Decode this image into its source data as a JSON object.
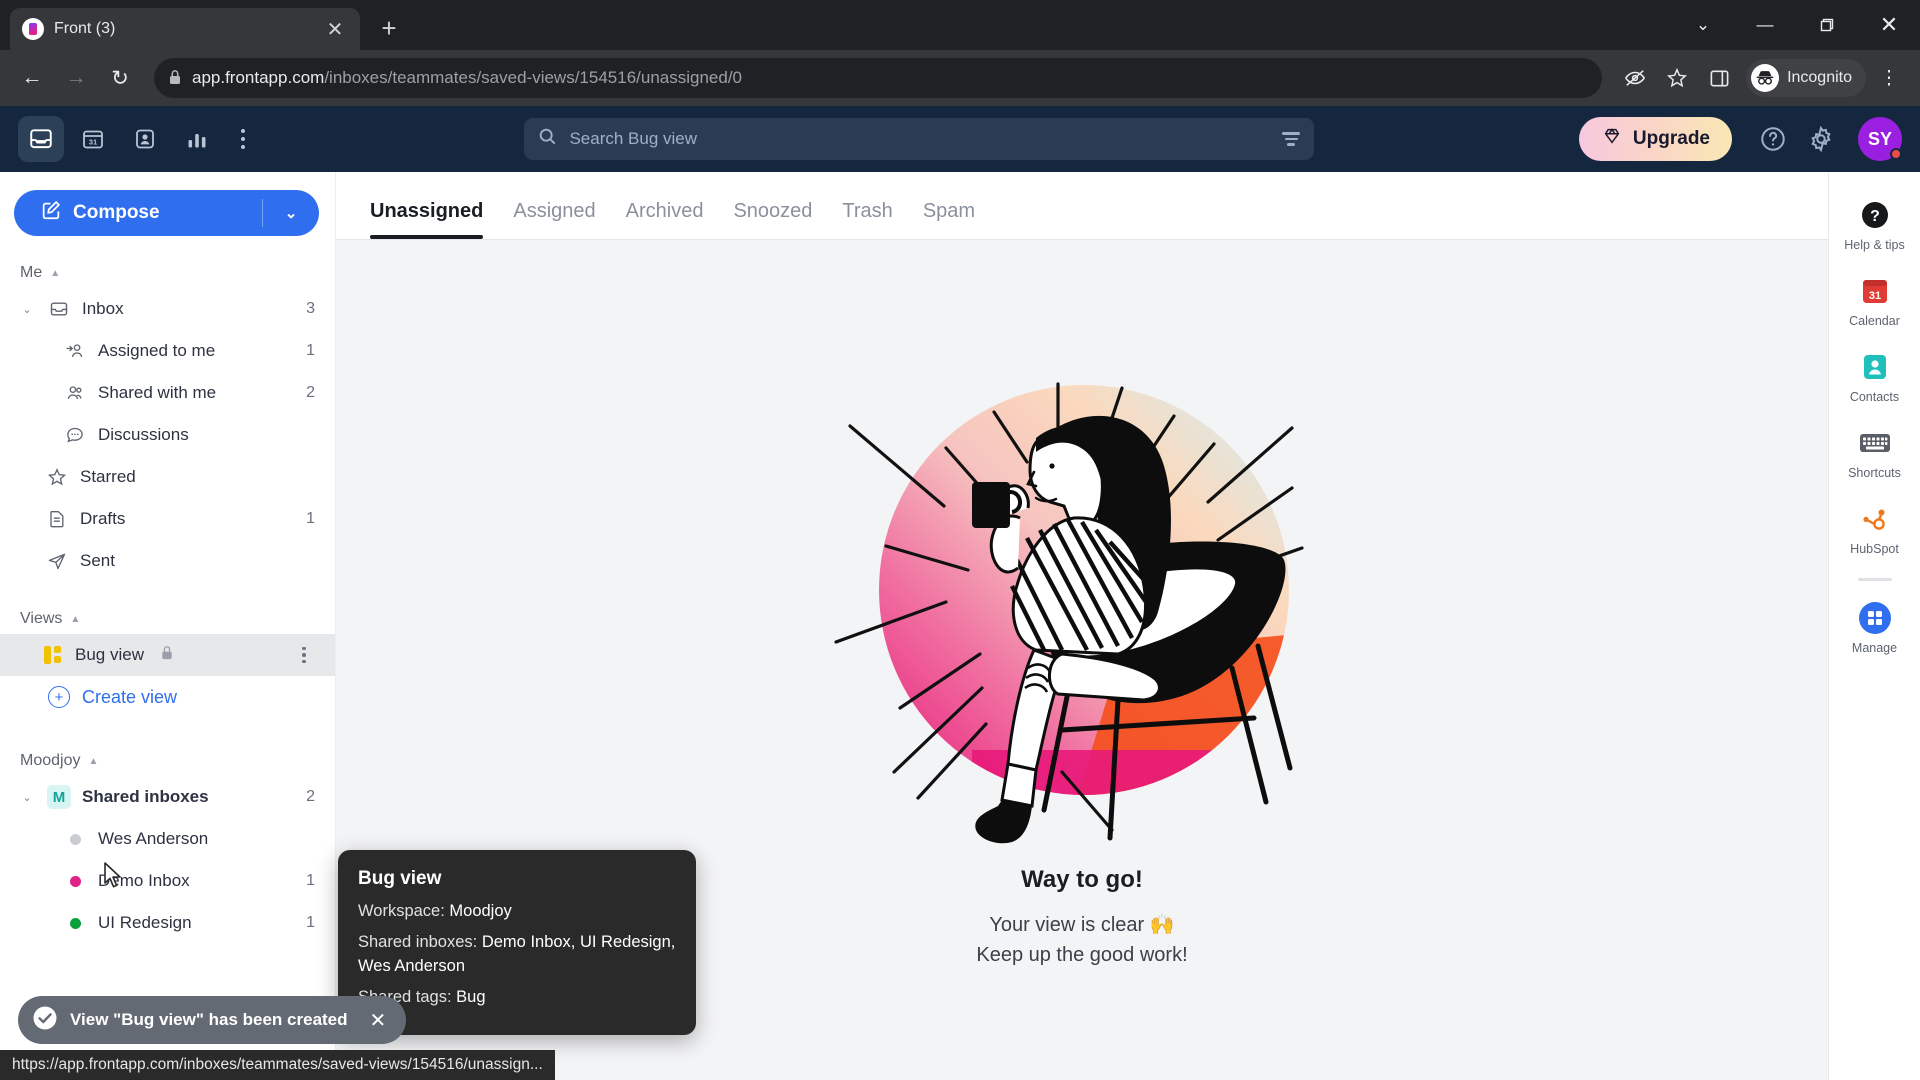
{
  "browser": {
    "tab": {
      "title": "Front (3)",
      "favicon": "front-logo-icon",
      "close_label": "✕"
    },
    "new_tab_label": "+",
    "window_controls": {
      "minimize_group": "⌄",
      "minimize": "—",
      "maximize": "❐",
      "close": "✕"
    },
    "nav": {
      "back": "←",
      "forward": "→",
      "reload": "↻"
    },
    "omnibox": {
      "lock_icon": "lock-icon",
      "url_domain": "app.frontapp.com",
      "url_path": "/inboxes/teammates/saved-views/154516/unassigned/0"
    },
    "toolbar_icons": [
      {
        "name": "third-party-cookies-blocked-icon",
        "glyph": "⌾"
      },
      {
        "name": "bookmark-star-icon",
        "glyph": "☆"
      },
      {
        "name": "side-panel-icon",
        "glyph": "▧"
      }
    ],
    "incognito_label": "Incognito",
    "menu_glyph": "⋮"
  },
  "app_header": {
    "nav_icons": [
      {
        "name": "inbox-icon",
        "label": "Inbox",
        "active": true
      },
      {
        "name": "calendar-icon",
        "label": "Calendar",
        "active": false
      },
      {
        "name": "contacts-icon",
        "label": "Contacts",
        "active": false
      },
      {
        "name": "analytics-icon",
        "label": "Analytics",
        "active": false
      }
    ],
    "more_menu": "more-options-icon",
    "search": {
      "placeholder": "Search Bug view",
      "value": "",
      "icon": "search-icon",
      "filter_icon": "filter-icon"
    },
    "upgrade_label": "Upgrade",
    "upgrade_icon": "diamond-icon",
    "help_icon": "help-circle-icon",
    "settings_icon": "gear-icon",
    "avatar_initials": "SY"
  },
  "sidebar": {
    "compose_label": "Compose",
    "compose_icon": "compose-pencil-icon",
    "compose_caret": "⌄",
    "sections": [
      {
        "title": "Me",
        "caret": "▲",
        "items": [
          {
            "label": "Inbox",
            "count": "3",
            "icon": "inbox-icon",
            "twisty": "⌄",
            "indent": 0
          },
          {
            "label": "Assigned to me",
            "count": "1",
            "icon": "assigned-person-icon",
            "indent": 1
          },
          {
            "label": "Shared with me",
            "count": "2",
            "icon": "shared-people-icon",
            "indent": 1
          },
          {
            "label": "Discussions",
            "count": "",
            "icon": "discussion-bubble-icon",
            "indent": 1
          },
          {
            "label": "Starred",
            "count": "",
            "icon": "star-icon",
            "indent": 0
          },
          {
            "label": "Drafts",
            "count": "1",
            "icon": "draft-document-icon",
            "indent": 0
          },
          {
            "label": "Sent",
            "count": "",
            "icon": "send-paper-plane-icon",
            "indent": 0
          }
        ]
      }
    ],
    "views": {
      "title": "Views",
      "caret": "▲",
      "selected_view": {
        "label": "Bug view",
        "lock_icon": "lock-icon",
        "icon": "view-columns-icon",
        "menu_icon": "kebab-menu-icon"
      },
      "create_label": "Create view",
      "create_icon": "plus-circle-icon"
    },
    "workspace": {
      "title": "Moodjoy",
      "caret": "▲",
      "shared_inboxes": {
        "label": "Shared inboxes",
        "count": "2",
        "badge": "M",
        "twisty": "⌄"
      },
      "inboxes": [
        {
          "label": "Wes Anderson",
          "count": "",
          "color": "#c9ccd1"
        },
        {
          "label": "Demo Inbox",
          "count": "1",
          "color": "#e0218a"
        },
        {
          "label": "UI Redesign",
          "count": "1",
          "color": "#0ca03c"
        }
      ]
    }
  },
  "tooltip": {
    "title": "Bug view",
    "workspace_label": "Workspace: ",
    "workspace_value": "Moodjoy",
    "inboxes_label": "Shared inboxes: ",
    "inboxes_value": "Demo Inbox, UI Redesign, Wes Anderson",
    "tags_label": "Shared tags: ",
    "tags_value": "Bug"
  },
  "main": {
    "tabs": [
      {
        "label": "Unassigned",
        "active": true
      },
      {
        "label": "Assigned",
        "active": false
      },
      {
        "label": "Archived",
        "active": false
      },
      {
        "label": "Snoozed",
        "active": false
      },
      {
        "label": "Trash",
        "active": false
      },
      {
        "label": "Spam",
        "active": false
      }
    ],
    "empty_state": {
      "illustration": "woman-sitting-in-chair-with-mug-illustration",
      "heading": "Way to go!",
      "line1": "Your view is clear 🙌",
      "line2": "Keep up the good work!"
    }
  },
  "rail": [
    {
      "label": "Help & tips",
      "icon": "help-circle-icon",
      "color": "#1a1a1a"
    },
    {
      "label": "Calendar",
      "icon": "calendar-31-icon",
      "color": "#e03b35"
    },
    {
      "label": "Contacts",
      "icon": "contacts-person-icon",
      "color": "#1fbfbb"
    },
    {
      "label": "Shortcuts",
      "icon": "keyboard-icon",
      "color": "#595e66"
    },
    {
      "label": "HubSpot",
      "icon": "hubspot-icon",
      "color": "#f2771a"
    },
    {
      "label": "Manage",
      "icon": "app-grid-icon",
      "color": "#2f6fef"
    }
  ],
  "toast": {
    "icon": "check-circle-icon",
    "message": "View \"Bug view\" has been created",
    "close": "✕"
  },
  "statusbar": {
    "url": "https://app.frontapp.com/inboxes/teammates/saved-views/154516/unassign..."
  }
}
